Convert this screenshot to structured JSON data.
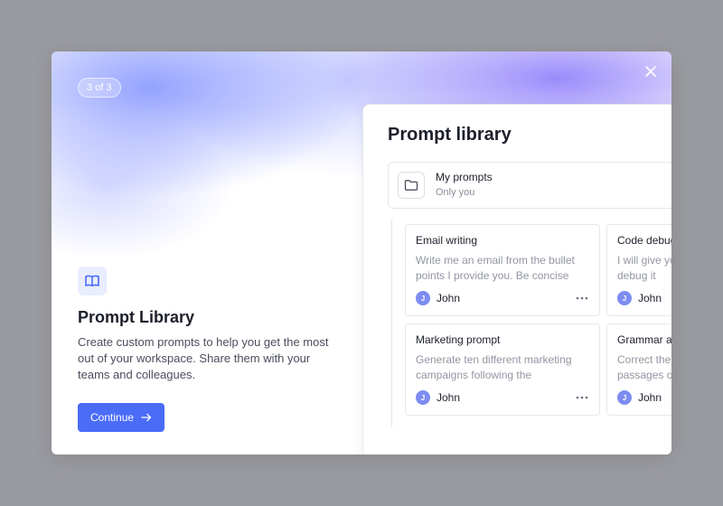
{
  "onboarding": {
    "step_label": "3 of 3",
    "feature_title": "Prompt Library",
    "feature_description": "Create custom prompts to help you get the most out of your workspace. Share them with your teams and colleagues.",
    "continue_label": "Continue",
    "accent_color": "#4a6cf7"
  },
  "panel": {
    "title": "Prompt library",
    "folder": {
      "name": "My prompts",
      "subtitle": "Only you"
    },
    "cards": [
      {
        "title": "Email writing",
        "description": "Write me an email from the bullet points I provide you. Be concise an…",
        "author_initial": "J",
        "author": "John"
      },
      {
        "title": "Code debug",
        "description": "I will give you code, please help me debug it",
        "author_initial": "J",
        "author": "John"
      },
      {
        "title": "Marketing prompt",
        "description": "Generate ten different marketing campaigns following the company…",
        "author_initial": "J",
        "author": "John"
      },
      {
        "title": "Grammar assistant",
        "description": "Correct the grammar in the passages of text",
        "author_initial": "J",
        "author": "John"
      }
    ]
  }
}
